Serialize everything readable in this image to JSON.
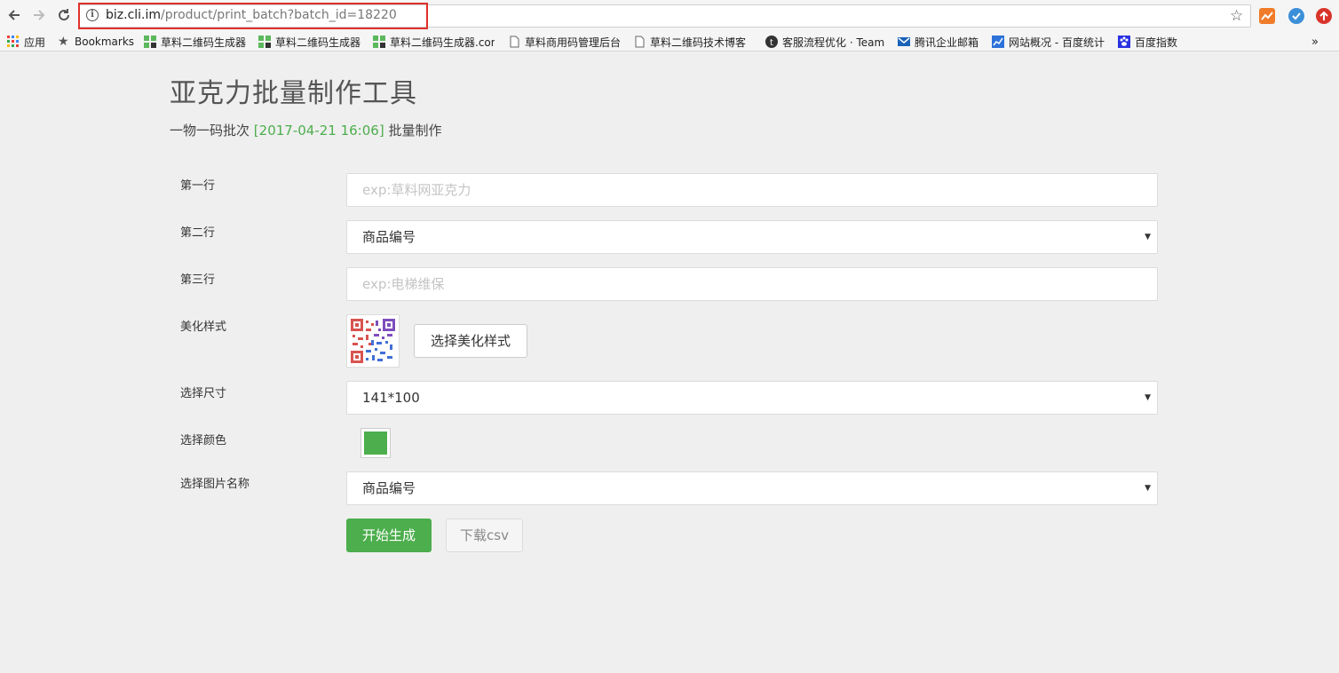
{
  "browser": {
    "url_host": "biz.cli.im",
    "url_path": "/product/print_batch?batch_id=18220",
    "ext_colors": [
      "#f07c2a",
      "#3b8fd9",
      "#d9342b"
    ]
  },
  "bookmarks": [
    {
      "label": "应用",
      "icon": "apps-grid-icon"
    },
    {
      "label": "Bookmarks",
      "icon": "star-icon"
    },
    {
      "label": "草料二维码生成器",
      "icon": "qr-logo-icon"
    },
    {
      "label": "草料二维码生成器",
      "icon": "qr-logo-icon"
    },
    {
      "label": "草料二维码生成器.com",
      "icon": "qr-logo-icon"
    },
    {
      "label": "草料商用码管理后台",
      "icon": "page-icon"
    },
    {
      "label": "草料二维码技术博客",
      "icon": "page-icon"
    },
    {
      "label": "客服流程优化 · Team",
      "icon": "teambition-icon"
    },
    {
      "label": "腾讯企业邮箱",
      "icon": "mail-icon"
    },
    {
      "label": "网站概况 - 百度统计",
      "icon": "chart-icon"
    },
    {
      "label": "百度指数",
      "icon": "paw-icon"
    }
  ],
  "bookmarks_overflow": "»",
  "page": {
    "title": "亚克力批量制作工具",
    "subtitle_prefix": "一物一码批次",
    "subtitle_date": "[2017-04-21 16:06]",
    "subtitle_suffix": "批量制作"
  },
  "form": {
    "line1_label": "第一行",
    "line1_placeholder": "exp:草料网亚克力",
    "line2_label": "第二行",
    "line2_value": "商品编号",
    "line3_label": "第三行",
    "line3_placeholder": "exp:电梯维保",
    "style_label": "美化样式",
    "style_button": "选择美化样式",
    "size_label": "选择尺寸",
    "size_value": "141*100",
    "color_label": "选择颜色",
    "color_value": "#4cae4c",
    "image_name_label": "选择图片名称",
    "image_name_value": "商品编号",
    "caret": "▼"
  },
  "actions": {
    "generate": "开始生成",
    "download_csv": "下载csv"
  }
}
